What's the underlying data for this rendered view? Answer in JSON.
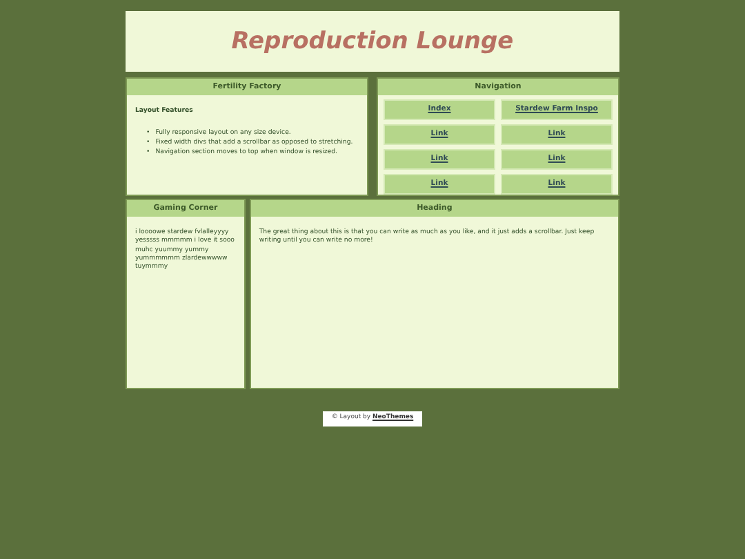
{
  "header": {
    "title": "Reproduction Lounge"
  },
  "fertility": {
    "title": "Fertility Factory",
    "subtitle": "Layout Features",
    "bullet": "•",
    "items": [
      "Fully responsive layout on any size device.",
      "Fixed width divs that add a scrollbar as opposed to stretching.",
      "Navigation section moves to top when window is resized."
    ]
  },
  "navigation": {
    "title": "Navigation",
    "links": [
      "Index",
      "Stardew Farm Inspo",
      "Link",
      "Link",
      "Link",
      "Link",
      "Link",
      "Link"
    ]
  },
  "gaming": {
    "title": "Gaming Corner",
    "text": "i loooowe stardew fvlalleyyyy yesssss mmmmm i love it sooo muhc yuummy yummy yummmmmm zlardewwwww tuymmmy"
  },
  "content": {
    "title": "Heading",
    "text": "The great thing about this is that you can write as much as you like, and it just adds a scrollbar. Just keep writing until you can write no more!"
  },
  "footer": {
    "text": "© Layout by",
    "link": "NeoThemes"
  }
}
